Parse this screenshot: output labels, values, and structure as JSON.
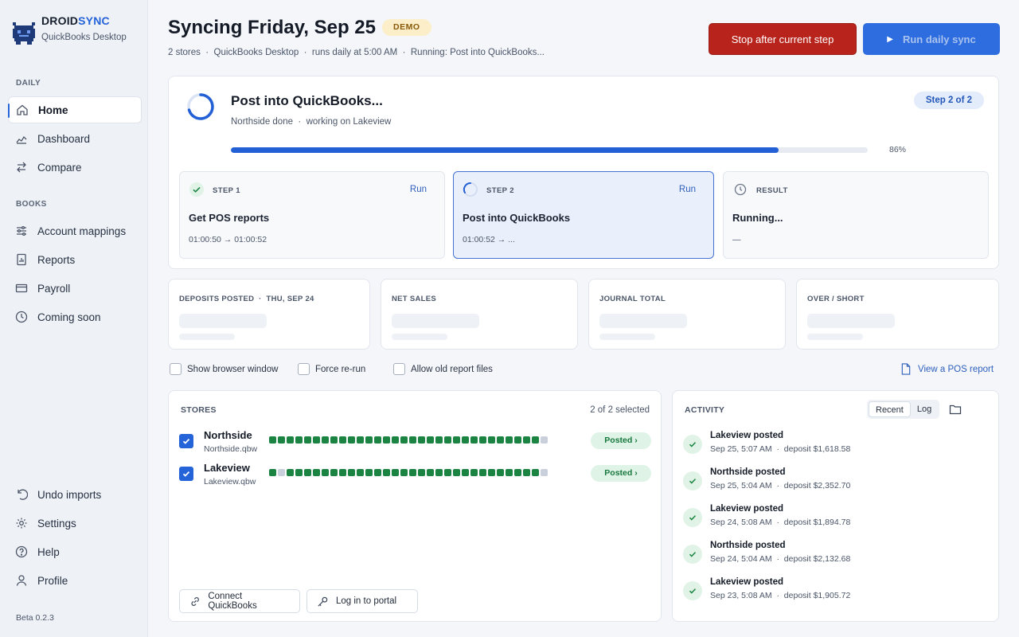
{
  "brand": {
    "name_main": "DROID",
    "name_accent": "SYNC",
    "subtitle": "QuickBooks Desktop",
    "accent_color": "#2563d9"
  },
  "sidebar": {
    "section_daily": "DAILY",
    "daily_items": [
      {
        "label": "Home",
        "icon": "home-icon",
        "active": true
      },
      {
        "label": "Dashboard",
        "icon": "dashboard-icon"
      },
      {
        "label": "Compare",
        "icon": "compare-icon"
      }
    ],
    "section_books": "BOOKS",
    "books_items": [
      {
        "label": "Account mappings",
        "icon": "sliders-icon"
      },
      {
        "label": "Reports",
        "icon": "report-icon"
      },
      {
        "label": "Payroll",
        "icon": "card-icon"
      },
      {
        "label": "Coming soon",
        "icon": "clock-icon"
      }
    ],
    "bottom_items": [
      {
        "label": "Undo imports",
        "icon": "undo-icon"
      },
      {
        "label": "Settings",
        "icon": "gear-icon"
      },
      {
        "label": "Help",
        "icon": "help-icon"
      },
      {
        "label": "Profile",
        "icon": "user-icon"
      }
    ],
    "version": "Beta 0.2.3"
  },
  "header": {
    "title": "Syncing Friday, Sep 25",
    "badge": "DEMO",
    "subline": "2 stores  ·  QuickBooks Desktop  ·  runs daily at 5:00 AM  ·  Running: Post into QuickBooks...",
    "stop_label": "Stop after current step",
    "run_label": "Run daily sync",
    "stop_color": "#b8241c",
    "run_color": "#2e6ddf"
  },
  "progress": {
    "title": "Post into QuickBooks...",
    "subtitle": "Northside done  ·  working on Lakeview",
    "step_badge": "Step 2 of 2",
    "percent": 86,
    "percent_label": "86%",
    "steps": [
      {
        "label": "STEP 1",
        "title": "Get POS reports",
        "time": "01:00:50 → 01:00:52",
        "run": "Run",
        "state": "done"
      },
      {
        "label": "STEP 2",
        "title": "Post into QuickBooks",
        "time": "01:00:52 → ...",
        "run": "Run",
        "state": "running"
      },
      {
        "label": "RESULT",
        "title": "Running...",
        "time": "—",
        "state": "pending"
      }
    ]
  },
  "stats": [
    {
      "label": "DEPOSITS POSTED  ·  THU, SEP 24"
    },
    {
      "label": "NET SALES"
    },
    {
      "label": "JOURNAL TOTAL"
    },
    {
      "label": "OVER / SHORT"
    }
  ],
  "options": {
    "show_browser": "Show browser window",
    "force_rerun": "Force re-run",
    "allow_old": "Allow old report files",
    "view_report": "View a POS report"
  },
  "stores": {
    "heading": "STORES",
    "selected": "2 of 2 selected",
    "rows": [
      {
        "name": "Northside",
        "file": "Northside.qbw",
        "status": "Posted ›",
        "history": "11111111111111111111111111111110"
      },
      {
        "name": "Lakeview",
        "file": "Lakeview.qbw",
        "status": "Posted ›",
        "history": "10111111111111111111111111111110"
      }
    ],
    "connect_label": "Connect QuickBooks",
    "portal_label": "Log in to portal"
  },
  "activity": {
    "heading": "ACTIVITY",
    "tab_recent": "Recent",
    "tab_log": "Log",
    "items": [
      {
        "title": "Lakeview posted",
        "meta": "Sep 25, 5:07 AM  ·  deposit $1,618.58"
      },
      {
        "title": "Northside posted",
        "meta": "Sep 25, 5:04 AM  ·  deposit $2,352.70"
      },
      {
        "title": "Lakeview posted",
        "meta": "Sep 24, 5:08 AM  ·  deposit $1,894.78"
      },
      {
        "title": "Northside posted",
        "meta": "Sep 24, 5:04 AM  ·  deposit $2,132.68"
      },
      {
        "title": "Lakeview posted",
        "meta": "Sep 23, 5:08 AM  ·  deposit $1,905.72"
      }
    ]
  }
}
